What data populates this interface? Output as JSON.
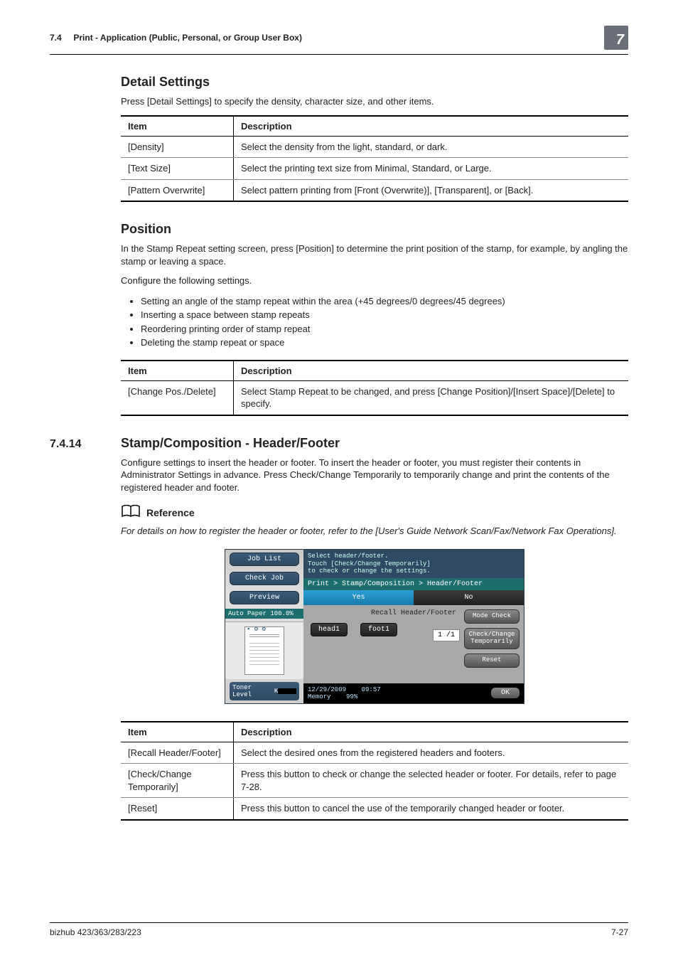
{
  "header": {
    "section_no": "7.4",
    "section_title": "Print - Application (Public, Personal, or Group User Box)",
    "chapter_badge": "7"
  },
  "detail_settings": {
    "heading": "Detail Settings",
    "intro": "Press [Detail Settings] to specify the density, character size, and other items.",
    "col_item": "Item",
    "col_desc": "Description",
    "rows": [
      {
        "item": "[Density]",
        "desc": "Select the density from the light, standard, or dark."
      },
      {
        "item": "[Text Size]",
        "desc": "Select the printing text size from Minimal, Standard, or Large."
      },
      {
        "item": "[Pattern Overwrite]",
        "desc": "Select pattern printing from [Front (Overwrite)], [Transparent], or [Back]."
      }
    ]
  },
  "position": {
    "heading": "Position",
    "intro": "In the Stamp Repeat setting screen, press [Position] to determine the print position of the stamp, for example, by angling the stamp or leaving a space.",
    "configure": "Configure the following settings.",
    "bullets": [
      "Setting an angle of the stamp repeat within the area (+45 degrees/0 degrees/45 degrees)",
      "Inserting a space between stamp repeats",
      "Reordering printing order of stamp repeat",
      "Deleting the stamp repeat or space"
    ],
    "col_item": "Item",
    "col_desc": "Description",
    "rows": [
      {
        "item": "[Change Pos./Delete]",
        "desc": "Select Stamp Repeat to be changed, and press [Change Position]/[Insert Space]/[Delete] to specify."
      }
    ]
  },
  "header_footer": {
    "num": "7.4.14",
    "title": "Stamp/Composition - Header/Footer",
    "intro": "Configure settings to insert the header or footer. To insert the header or footer, you must register their contents in Administrator Settings in advance. Press Check/Change Temporarily to temporarily change and print the contents of the registered header and footer.",
    "reference_label": "Reference",
    "reference_text": "For details on how to register the header or footer, refer to the [User's Guide Network Scan/Fax/Network Fax Operations].",
    "col_item": "Item",
    "col_desc": "Description",
    "rows": [
      {
        "item": "[Recall Header/Footer]",
        "desc": "Select the desired ones from the registered headers and footers."
      },
      {
        "item": "[Check/Change Temporarily]",
        "desc": "Press this button to check or change the selected header or footer. For details, refer to page 7-28."
      },
      {
        "item": "[Reset]",
        "desc": "Press this button to cancel the use of the temporarily changed header or footer."
      }
    ]
  },
  "panel": {
    "left_tabs": {
      "job_list": "Job List",
      "check_job": "Check Job",
      "preview": "Preview"
    },
    "auto_paper": "Auto Paper  100.0%",
    "toner": {
      "label": "Toner Level",
      "k": "K"
    },
    "msg": {
      "l1": "Select header/footer.",
      "l2": "Touch [Check/Change Temporarily]",
      "l3": "to check or change the settings."
    },
    "crumb": "Print > Stamp/Composition > Header/Footer",
    "yes": "Yes",
    "no": "No",
    "recall_caption": "Recall Header/Footer",
    "chips": {
      "head1": "head1",
      "foot1": "foot1"
    },
    "pager": "1  /1",
    "right_buttons": {
      "mode_check": "Mode Check",
      "check_change": "Check/Change Temporarily",
      "reset": "Reset"
    },
    "status": {
      "date": "12/29/2009",
      "time": "09:57",
      "memory_label": "Memory",
      "memory_value": "99%",
      "ok": "OK"
    }
  },
  "footer": {
    "model": "bizhub 423/363/283/223",
    "page": "7-27"
  }
}
